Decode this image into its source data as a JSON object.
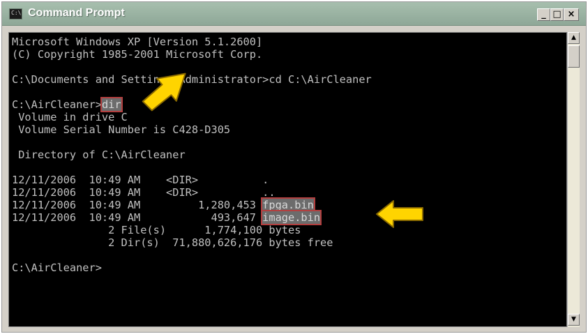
{
  "window": {
    "title": "Command Prompt",
    "icon_label": "C:\\",
    "controls": {
      "minimize": "_",
      "maximize": "□",
      "close": "×"
    }
  },
  "console": {
    "lines": [
      "Microsoft Windows XP [Version 5.1.2600]",
      "(C) Copyright 1985-2001 Microsoft Corp.",
      "",
      "C:\\Documents and Settings\\Administrator>cd C:\\AirCleaner",
      "",
      "C:\\AirCleaner>",
      " Volume in drive C",
      " Volume Serial Number is C428-D305",
      "",
      " Directory of C:\\AirCleaner",
      "",
      "12/11/2006  10:49 AM    <DIR>          .",
      "12/11/2006  10:49 AM    <DIR>          ..",
      "12/11/2006  10:49 AM         1,280,453 ",
      "12/11/2006  10:49 AM           493,647 ",
      "               2 File(s)      1,774,100 bytes",
      "               2 Dir(s)  71,880,626,176 bytes free",
      "",
      "C:\\AirCleaner>"
    ],
    "highlights": {
      "command": "dir",
      "file1": "fpga.bin",
      "file2": "image.bin"
    }
  },
  "scrollbar": {
    "up_arrow": "▲",
    "down_arrow": "▼"
  },
  "colors": {
    "terminal_bg": "#000000",
    "terminal_text": "#c0c0c0",
    "title_bar": "#9db5a4",
    "highlight_border": "#b33f3f",
    "annotation_arrow": "#ffd400"
  },
  "icons": {
    "annotation": "arrow-pointer-icon"
  }
}
